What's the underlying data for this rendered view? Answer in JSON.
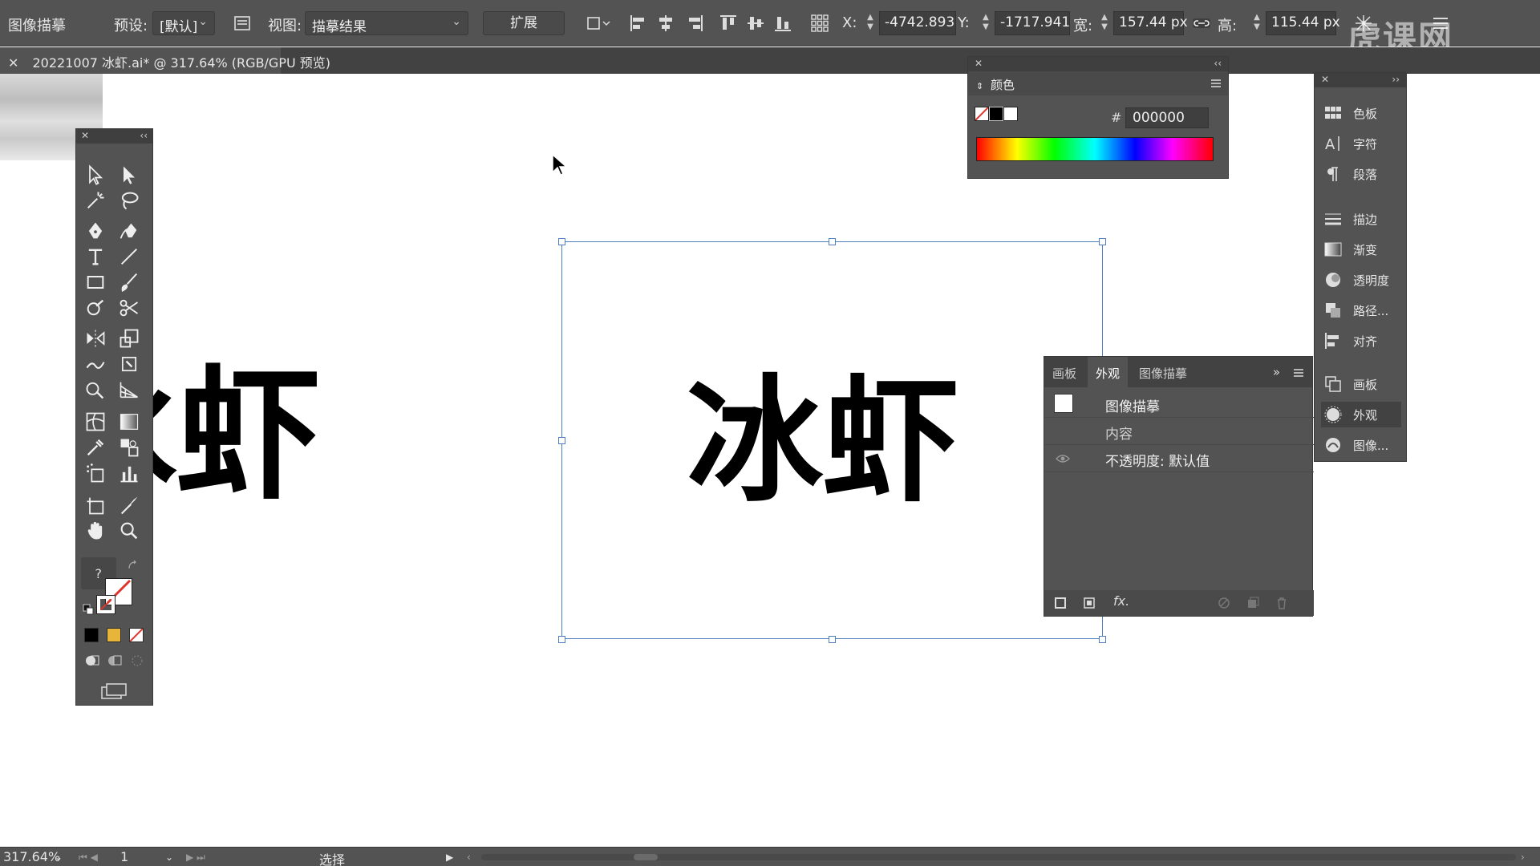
{
  "control_bar": {
    "mode_label": "图像描摹",
    "preset_label": "预设:",
    "preset_value": "[默认]",
    "view_label": "视图:",
    "view_value": "描摹结果",
    "expand_button": "扩展",
    "x_label": "X:",
    "x_value": "-4742.893",
    "y_label": "Y:",
    "y_value": "-1717.941",
    "w_label": "宽:",
    "w_value": "157.44 px",
    "h_label": "高:",
    "h_value": "115.44 px"
  },
  "document_tab": {
    "title": "20221007 冰虾.ai* @ 317.64% (RGB/GPU 预览)"
  },
  "canvas": {
    "left_partial_text": "冰虾",
    "traced_text": "冰虾"
  },
  "color_panel": {
    "title": "颜色",
    "hash": "#",
    "hex_value": "000000"
  },
  "dock": {
    "items": [
      {
        "label": "色板",
        "icon": "swatches-icon"
      },
      {
        "label": "字符",
        "icon": "character-icon"
      },
      {
        "label": "段落",
        "icon": "paragraph-icon"
      },
      {
        "label": "描边",
        "icon": "stroke-icon"
      },
      {
        "label": "渐变",
        "icon": "gradient-icon"
      },
      {
        "label": "透明度",
        "icon": "transparency-icon"
      },
      {
        "label": "路径...",
        "icon": "pathfinder-icon"
      },
      {
        "label": "对齐",
        "icon": "align-icon"
      },
      {
        "label": "画板",
        "icon": "artboard-icon"
      },
      {
        "label": "外观",
        "icon": "appearance-icon"
      },
      {
        "label": "图像...",
        "icon": "image-trace-icon"
      }
    ]
  },
  "appearance_panel": {
    "tabs": [
      "画板",
      "外观",
      "图像描摹"
    ],
    "active_tab": "外观",
    "rows": {
      "object": "图像描摹",
      "contents": "内容",
      "opacity": "不透明度: 默认值"
    }
  },
  "status_bar": {
    "zoom": "317.64%",
    "artboard": "1",
    "tool": "选择"
  },
  "watermark": "虎课网"
}
